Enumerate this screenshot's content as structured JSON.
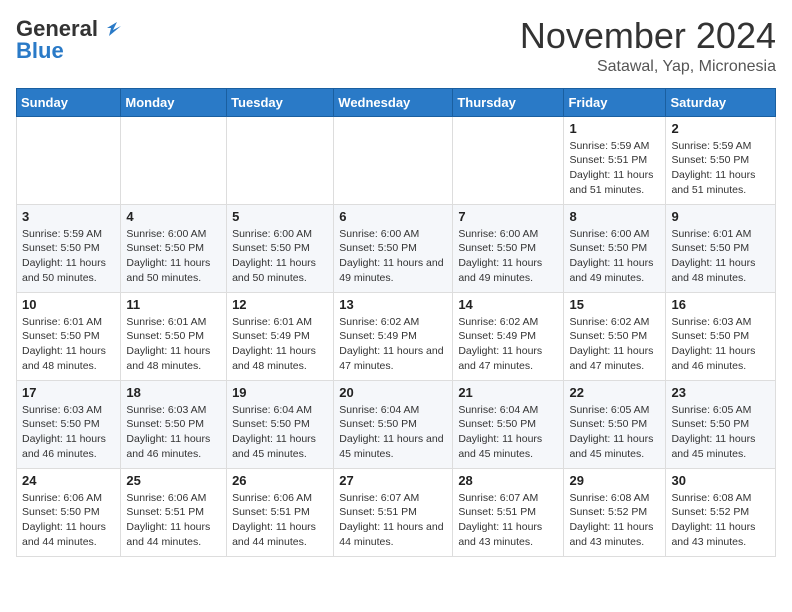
{
  "logo": {
    "line1": "General",
    "line2": "Blue"
  },
  "header": {
    "month": "November 2024",
    "location": "Satawal, Yap, Micronesia"
  },
  "weekdays": [
    "Sunday",
    "Monday",
    "Tuesday",
    "Wednesday",
    "Thursday",
    "Friday",
    "Saturday"
  ],
  "weeks": [
    [
      {
        "day": "",
        "info": ""
      },
      {
        "day": "",
        "info": ""
      },
      {
        "day": "",
        "info": ""
      },
      {
        "day": "",
        "info": ""
      },
      {
        "day": "",
        "info": ""
      },
      {
        "day": "1",
        "info": "Sunrise: 5:59 AM\nSunset: 5:51 PM\nDaylight: 11 hours and 51 minutes."
      },
      {
        "day": "2",
        "info": "Sunrise: 5:59 AM\nSunset: 5:50 PM\nDaylight: 11 hours and 51 minutes."
      }
    ],
    [
      {
        "day": "3",
        "info": "Sunrise: 5:59 AM\nSunset: 5:50 PM\nDaylight: 11 hours and 50 minutes."
      },
      {
        "day": "4",
        "info": "Sunrise: 6:00 AM\nSunset: 5:50 PM\nDaylight: 11 hours and 50 minutes."
      },
      {
        "day": "5",
        "info": "Sunrise: 6:00 AM\nSunset: 5:50 PM\nDaylight: 11 hours and 50 minutes."
      },
      {
        "day": "6",
        "info": "Sunrise: 6:00 AM\nSunset: 5:50 PM\nDaylight: 11 hours and 49 minutes."
      },
      {
        "day": "7",
        "info": "Sunrise: 6:00 AM\nSunset: 5:50 PM\nDaylight: 11 hours and 49 minutes."
      },
      {
        "day": "8",
        "info": "Sunrise: 6:00 AM\nSunset: 5:50 PM\nDaylight: 11 hours and 49 minutes."
      },
      {
        "day": "9",
        "info": "Sunrise: 6:01 AM\nSunset: 5:50 PM\nDaylight: 11 hours and 48 minutes."
      }
    ],
    [
      {
        "day": "10",
        "info": "Sunrise: 6:01 AM\nSunset: 5:50 PM\nDaylight: 11 hours and 48 minutes."
      },
      {
        "day": "11",
        "info": "Sunrise: 6:01 AM\nSunset: 5:50 PM\nDaylight: 11 hours and 48 minutes."
      },
      {
        "day": "12",
        "info": "Sunrise: 6:01 AM\nSunset: 5:49 PM\nDaylight: 11 hours and 48 minutes."
      },
      {
        "day": "13",
        "info": "Sunrise: 6:02 AM\nSunset: 5:49 PM\nDaylight: 11 hours and 47 minutes."
      },
      {
        "day": "14",
        "info": "Sunrise: 6:02 AM\nSunset: 5:49 PM\nDaylight: 11 hours and 47 minutes."
      },
      {
        "day": "15",
        "info": "Sunrise: 6:02 AM\nSunset: 5:50 PM\nDaylight: 11 hours and 47 minutes."
      },
      {
        "day": "16",
        "info": "Sunrise: 6:03 AM\nSunset: 5:50 PM\nDaylight: 11 hours and 46 minutes."
      }
    ],
    [
      {
        "day": "17",
        "info": "Sunrise: 6:03 AM\nSunset: 5:50 PM\nDaylight: 11 hours and 46 minutes."
      },
      {
        "day": "18",
        "info": "Sunrise: 6:03 AM\nSunset: 5:50 PM\nDaylight: 11 hours and 46 minutes."
      },
      {
        "day": "19",
        "info": "Sunrise: 6:04 AM\nSunset: 5:50 PM\nDaylight: 11 hours and 45 minutes."
      },
      {
        "day": "20",
        "info": "Sunrise: 6:04 AM\nSunset: 5:50 PM\nDaylight: 11 hours and 45 minutes."
      },
      {
        "day": "21",
        "info": "Sunrise: 6:04 AM\nSunset: 5:50 PM\nDaylight: 11 hours and 45 minutes."
      },
      {
        "day": "22",
        "info": "Sunrise: 6:05 AM\nSunset: 5:50 PM\nDaylight: 11 hours and 45 minutes."
      },
      {
        "day": "23",
        "info": "Sunrise: 6:05 AM\nSunset: 5:50 PM\nDaylight: 11 hours and 45 minutes."
      }
    ],
    [
      {
        "day": "24",
        "info": "Sunrise: 6:06 AM\nSunset: 5:50 PM\nDaylight: 11 hours and 44 minutes."
      },
      {
        "day": "25",
        "info": "Sunrise: 6:06 AM\nSunset: 5:51 PM\nDaylight: 11 hours and 44 minutes."
      },
      {
        "day": "26",
        "info": "Sunrise: 6:06 AM\nSunset: 5:51 PM\nDaylight: 11 hours and 44 minutes."
      },
      {
        "day": "27",
        "info": "Sunrise: 6:07 AM\nSunset: 5:51 PM\nDaylight: 11 hours and 44 minutes."
      },
      {
        "day": "28",
        "info": "Sunrise: 6:07 AM\nSunset: 5:51 PM\nDaylight: 11 hours and 43 minutes."
      },
      {
        "day": "29",
        "info": "Sunrise: 6:08 AM\nSunset: 5:52 PM\nDaylight: 11 hours and 43 minutes."
      },
      {
        "day": "30",
        "info": "Sunrise: 6:08 AM\nSunset: 5:52 PM\nDaylight: 11 hours and 43 minutes."
      }
    ]
  ]
}
